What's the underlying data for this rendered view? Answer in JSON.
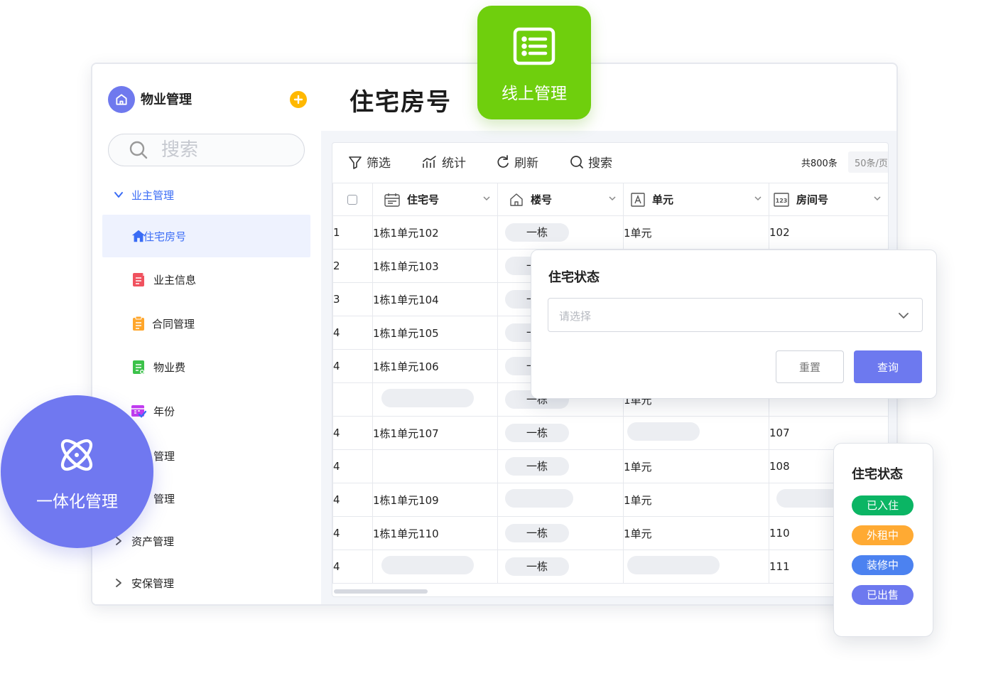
{
  "sidebar": {
    "app_title": "物业管理",
    "search_placeholder": "搜索",
    "groups": [
      {
        "label": "业主管理",
        "expanded": true
      },
      {
        "label": "资产管理",
        "expanded": false
      },
      {
        "label": "安保管理",
        "expanded": false
      }
    ],
    "items": [
      {
        "label": "住宅房号",
        "icon": "home-icon",
        "active": true
      },
      {
        "label": "业主信息",
        "icon": "owner-info-icon"
      },
      {
        "label": "合同管理",
        "icon": "contract-icon"
      },
      {
        "label": "物业费",
        "icon": "fee-icon"
      },
      {
        "label": "年份",
        "icon": "calendar-check-icon"
      },
      {
        "label": "管理"
      },
      {
        "label": "管理"
      }
    ]
  },
  "main": {
    "page_title": "住宅房号",
    "toolbar": {
      "filter": "筛选",
      "stats": "统计",
      "refresh": "刷新",
      "search": "搜索",
      "total": "共800条",
      "page_size": "50条/页"
    },
    "columns": [
      "住宅号",
      "楼号",
      "单元",
      "房间号"
    ],
    "rows": [
      {
        "idx": "1",
        "house": "1栋1单元102",
        "building": "一栋",
        "unit": "1单元",
        "room": "102"
      },
      {
        "idx": "2",
        "house": "1栋1单元103",
        "building": "一栋",
        "unit": "",
        "room": ""
      },
      {
        "idx": "3",
        "house": "1栋1单元104",
        "building": "一栋",
        "unit": "",
        "room": ""
      },
      {
        "idx": "4",
        "house": "1栋1单元105",
        "building": "一栋",
        "unit": "",
        "room": ""
      },
      {
        "idx": "4",
        "house": "1栋1单元106",
        "building": "一栋",
        "unit": "",
        "room": ""
      },
      {
        "idx": "",
        "house": "",
        "building": "一栋",
        "unit": "1单元",
        "room": ""
      },
      {
        "idx": "4",
        "house": "1栋1单元107",
        "building": "一栋",
        "unit": "",
        "room": "107"
      },
      {
        "idx": "4",
        "house": "",
        "building": "一栋",
        "unit": "1单元",
        "room": "108"
      },
      {
        "idx": "4",
        "house": "1栋1单元109",
        "building": "",
        "unit": "1单元",
        "room": ""
      },
      {
        "idx": "4",
        "house": "1栋1单元110",
        "building": "一栋",
        "unit": "1单元",
        "room": "110"
      },
      {
        "idx": "4",
        "house": "",
        "building": "一栋",
        "unit": "",
        "room": "111"
      }
    ]
  },
  "badges": {
    "online": "线上管理",
    "integrated": "一体化管理"
  },
  "filter_popup": {
    "title": "住宅状态",
    "placeholder": "请选择",
    "reset": "重置",
    "query": "查询"
  },
  "status_card": {
    "title": "住宅状态",
    "tags": [
      {
        "label": "已入住",
        "color": "#0bb564"
      },
      {
        "label": "外租中",
        "color": "#ffaa33"
      },
      {
        "label": "装修中",
        "color": "#4c82f0"
      },
      {
        "label": "已出售",
        "color": "#6d79ef"
      }
    ]
  },
  "colors": {
    "accent": "#6d79ef",
    "active_nav": "#3a6cf5",
    "online_badge": "#6fcf0d",
    "add_button": "#ffb800"
  }
}
